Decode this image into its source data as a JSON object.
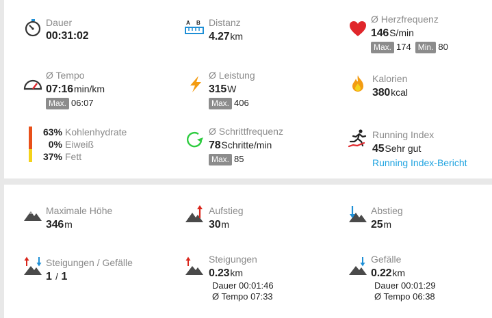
{
  "summary": {
    "duration": {
      "label": "Dauer",
      "value": "00:31:02",
      "icon": "stopwatch-icon"
    },
    "distance": {
      "label": "Distanz",
      "value": "4.27",
      "unit": "km",
      "icon": "ruler-ab-icon",
      "icon_text_a": "A",
      "icon_text_b": "B"
    },
    "heart_rate": {
      "label": "Ø Herzfrequenz",
      "value": "146",
      "unit": "S/min",
      "max_label": "Max.",
      "max_value": "174",
      "min_label": "Min.",
      "min_value": "80",
      "icon": "heart-icon"
    },
    "pace": {
      "label": "Ø Tempo",
      "value": "07:16",
      "unit": "min/km",
      "max_label": "Max.",
      "max_value": "06:07",
      "icon": "speedometer-icon"
    },
    "power": {
      "label": "Ø Leistung",
      "value": "315",
      "unit": "W",
      "max_label": "Max.",
      "max_value": "406",
      "icon": "lightning-icon"
    },
    "calories": {
      "label": "Kalorien",
      "value": "380",
      "unit": "kcal",
      "icon": "flame-icon"
    },
    "macros": {
      "icon": "macro-bar-icon",
      "items": [
        {
          "pct": "63%",
          "name": "Kohlenhydrate",
          "color": "#e8501a",
          "fraction": 0.63
        },
        {
          "pct": "0%",
          "name": "Eiweiß",
          "color": "#c0392b",
          "fraction": 0.0
        },
        {
          "pct": "37%",
          "name": "Fett",
          "color": "#f4d21a",
          "fraction": 0.37
        }
      ]
    },
    "cadence": {
      "label": "Ø Schrittfrequenz",
      "value": "78",
      "unit": "Schritte/min",
      "max_label": "Max.",
      "max_value": "85",
      "icon": "cadence-arrow-icon"
    },
    "running_index": {
      "label": "Running Index",
      "value": "45",
      "unit": "Sehr gut",
      "link": "Running Index-Bericht",
      "icon": "runner-icon"
    }
  },
  "elevation": {
    "max_height": {
      "label": "Maximale Höhe",
      "value": "346",
      "unit": "m",
      "icon": "mountain-icon"
    },
    "ascent": {
      "label": "Aufstieg",
      "value": "30",
      "unit": "m",
      "icon": "mountain-up-icon"
    },
    "descent": {
      "label": "Abstieg",
      "value": "25",
      "unit": "m",
      "icon": "mountain-down-icon"
    },
    "ascents_descents": {
      "label": "Steigungen / Gefälle",
      "value_a": "1",
      "sep": "/",
      "value_b": "1",
      "icon": "mountain-updown-icon"
    },
    "inclines": {
      "label": "Steigungen",
      "value": "0.23",
      "unit": "km",
      "duration": "Dauer 00:01:46",
      "pace": "Ø Tempo 07:33",
      "icon": "mountain-up-icon"
    },
    "declines": {
      "label": "Gefälle",
      "value": "0.22",
      "unit": "km",
      "duration": "Dauer 00:01:29",
      "pace": "Ø Tempo 06:38",
      "icon": "mountain-down-icon"
    }
  },
  "colors": {
    "accent_link": "#1ea3e0",
    "up_arrow": "#d9261c",
    "down_arrow": "#1e8fd6",
    "badge": "#8c8c8c"
  }
}
